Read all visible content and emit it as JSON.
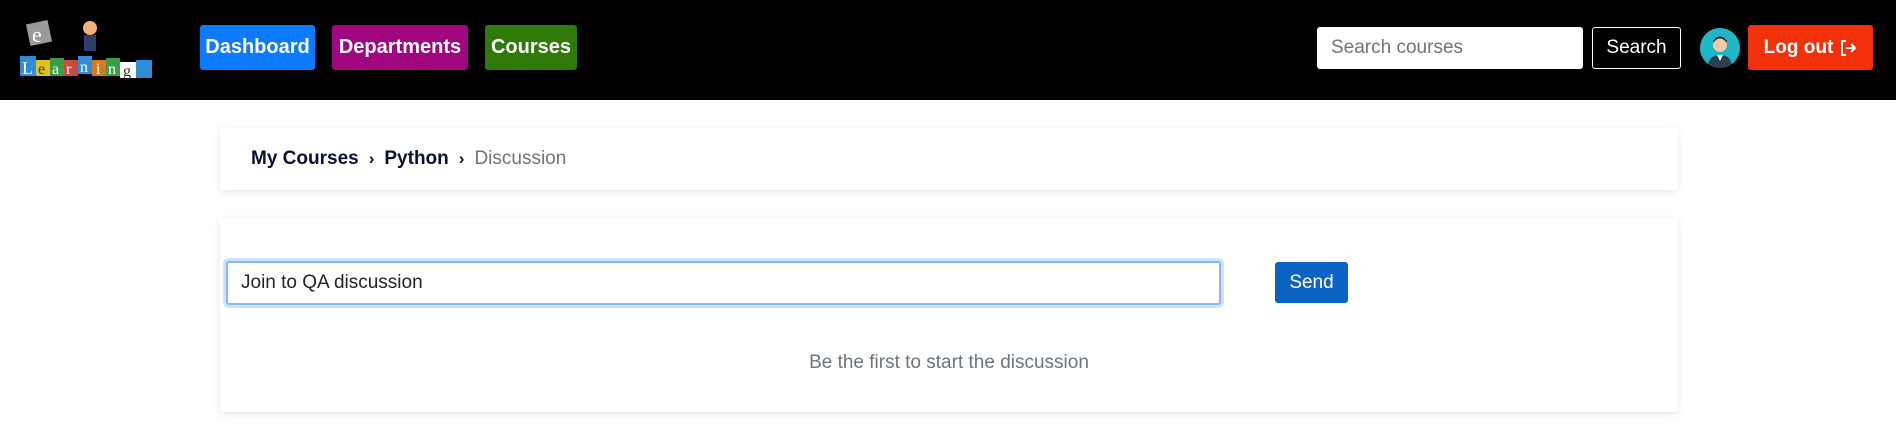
{
  "navbar": {
    "logo_text": "eLearning",
    "buttons": [
      {
        "label": "Dashboard",
        "color": "#0d7bff"
      },
      {
        "label": "Departments",
        "color": "#a0077f"
      },
      {
        "label": "Courses",
        "color": "#2f7a08"
      }
    ],
    "search": {
      "placeholder": "Search courses",
      "value": "",
      "button_label": "Search"
    },
    "logout_label": "Log out",
    "logout_color": "#f2300a"
  },
  "breadcrumb": {
    "items": [
      "My Courses",
      "Python"
    ],
    "current": "Discussion"
  },
  "discussion": {
    "input_value": "Join to QA discussion",
    "send_label": "Send",
    "empty_message": "Be the first to start the discussion"
  }
}
